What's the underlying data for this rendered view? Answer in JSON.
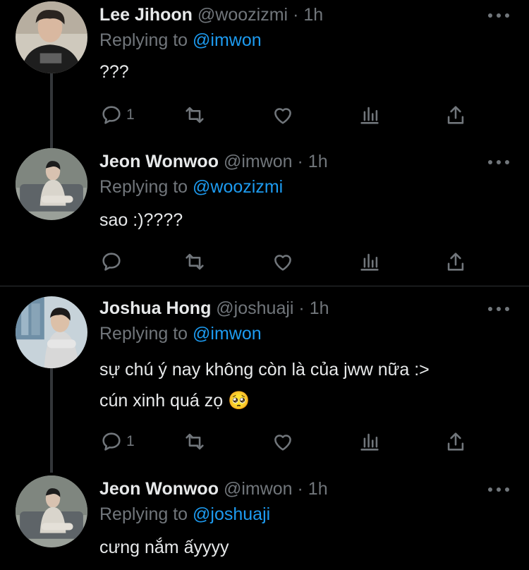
{
  "tweets": [
    {
      "name": "Lee Jihoon",
      "handle": "@woozizmi",
      "dot": "·",
      "time": "1h",
      "replying_prefix": "Replying to",
      "replying_to": "@imwon",
      "text_lines": [
        "???"
      ],
      "reply_count": "1",
      "icons": [
        "reply-icon",
        "retweet-icon",
        "like-icon",
        "analytics-icon",
        "share-icon"
      ]
    },
    {
      "name": "Jeon Wonwoo",
      "handle": "@imwon",
      "dot": "·",
      "time": "1h",
      "replying_prefix": "Replying to",
      "replying_to": "@woozizmi",
      "text_lines": [
        "sao :)????"
      ],
      "reply_count": "",
      "icons": [
        "reply-icon",
        "retweet-icon",
        "like-icon",
        "analytics-icon",
        "share-icon"
      ]
    },
    {
      "name": "Joshua Hong",
      "handle": "@joshuaji",
      "dot": "·",
      "time": "1h",
      "replying_prefix": "Replying to",
      "replying_to": "@imwon",
      "text_lines": [
        "sự chú ý nay không còn là của jww nữa :>",
        "cún xinh quá zọ 🥺"
      ],
      "reply_count": "1",
      "icons": [
        "reply-icon",
        "retweet-icon",
        "like-icon",
        "analytics-icon",
        "share-icon"
      ]
    },
    {
      "name": "Jeon Wonwoo",
      "handle": "@imwon",
      "dot": "·",
      "time": "1h",
      "replying_prefix": "Replying to",
      "replying_to": "@joshuaji",
      "text_lines": [
        "cưng nắm ấyyyy"
      ]
    }
  ],
  "colors": {
    "background": "#000000",
    "text": "#e7e9ea",
    "muted": "#71767b",
    "link": "#1d9bf0",
    "thread_line": "#333639",
    "divider": "#2f3336"
  }
}
